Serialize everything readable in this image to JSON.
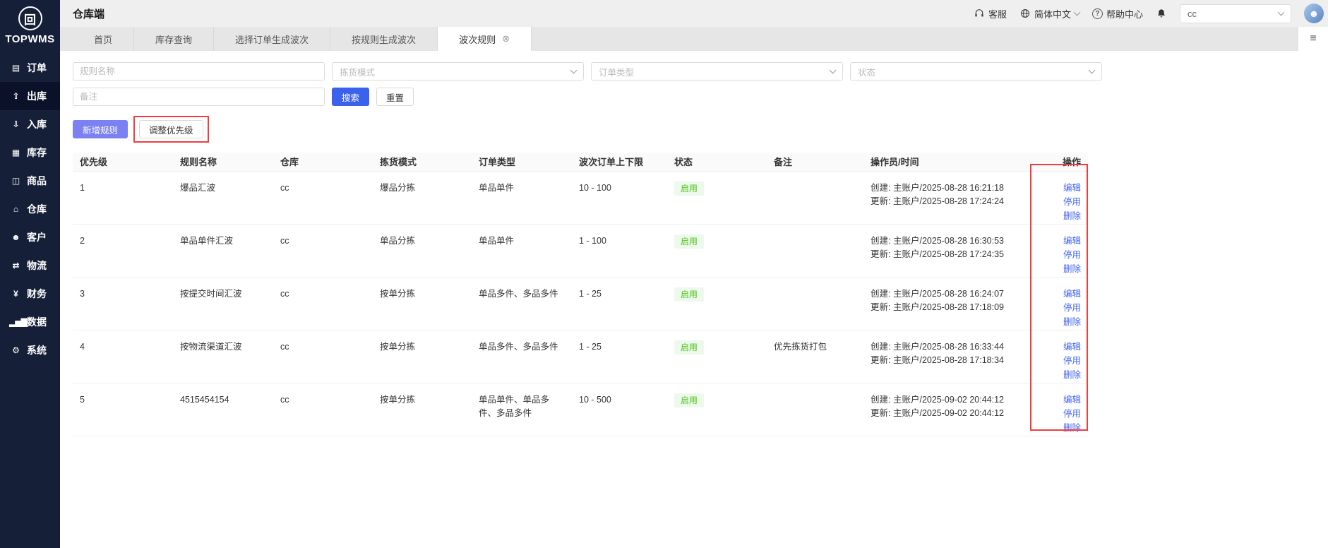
{
  "app": {
    "logo_text": "TOPWMS",
    "title": "仓库端"
  },
  "header": {
    "customer_service": "客服",
    "language": "简体中文",
    "help_center": "帮助中心",
    "warehouse_select_value": "cc"
  },
  "sidebar": {
    "items": [
      {
        "label": "订单",
        "glyph": "▤"
      },
      {
        "label": "出库",
        "glyph": "⇧"
      },
      {
        "label": "入库",
        "glyph": "⇩"
      },
      {
        "label": "库存",
        "glyph": "▦"
      },
      {
        "label": "商品",
        "glyph": "◫"
      },
      {
        "label": "仓库",
        "glyph": "⌂"
      },
      {
        "label": "客户",
        "glyph": "☻"
      },
      {
        "label": "物流",
        "glyph": "⇄"
      },
      {
        "label": "财务",
        "glyph": "¥"
      },
      {
        "label": "数据",
        "glyph": "▂▅▇"
      },
      {
        "label": "系统",
        "glyph": "⚙"
      }
    ]
  },
  "tabs": {
    "items": [
      {
        "label": "首页"
      },
      {
        "label": "库存查询"
      },
      {
        "label": "选择订单生成波次"
      },
      {
        "label": "按规则生成波次"
      },
      {
        "label": "波次规则"
      }
    ],
    "close_glyph": "⊗",
    "menu_glyph": "≡"
  },
  "filters": {
    "rule_name_placeholder": "规则名称",
    "pick_mode_placeholder": "拣货模式",
    "order_type_placeholder": "订单类型",
    "status_placeholder": "状态",
    "remark_placeholder": "备注",
    "search": "搜索",
    "reset": "重置"
  },
  "toolbar": {
    "add_rule": "新增规则",
    "adjust_priority": "调整优先级"
  },
  "table": {
    "headers": [
      "优先级",
      "规则名称",
      "仓库",
      "拣货模式",
      "订单类型",
      "波次订单上下限",
      "状态",
      "备注",
      "操作员/时间",
      "操作"
    ],
    "created_label": "创建:",
    "updated_label": "更新:",
    "actions": {
      "edit": "编辑",
      "disable": "停用",
      "delete": "删除"
    },
    "rows": [
      {
        "priority": "1",
        "rule_name": "爆品汇波",
        "warehouse": "cc",
        "pick_mode": "爆品分拣",
        "order_type": "单品单件",
        "wave_limit": "10 - 100",
        "status": "启用",
        "remark": "",
        "created": "主账户/2025-08-28 16:21:18",
        "updated": "主账户/2025-08-28 17:24:24"
      },
      {
        "priority": "2",
        "rule_name": "单品单件汇波",
        "warehouse": "cc",
        "pick_mode": "单品分拣",
        "order_type": "单品单件",
        "wave_limit": "1 - 100",
        "status": "启用",
        "remark": "",
        "created": "主账户/2025-08-28 16:30:53",
        "updated": "主账户/2025-08-28 17:24:35"
      },
      {
        "priority": "3",
        "rule_name": "按提交时间汇波",
        "warehouse": "cc",
        "pick_mode": "按单分拣",
        "order_type": "单品多件、多品多件",
        "wave_limit": "1 - 25",
        "status": "启用",
        "remark": "",
        "created": "主账户/2025-08-28 16:24:07",
        "updated": "主账户/2025-08-28 17:18:09"
      },
      {
        "priority": "4",
        "rule_name": "按物流渠道汇波",
        "warehouse": "cc",
        "pick_mode": "按单分拣",
        "order_type": "单品多件、多品多件",
        "wave_limit": "1 - 25",
        "status": "启用",
        "remark": "优先拣货打包",
        "created": "主账户/2025-08-28 16:33:44",
        "updated": "主账户/2025-08-28 17:18:34"
      },
      {
        "priority": "5",
        "rule_name": "4515454154",
        "warehouse": "cc",
        "pick_mode": "按单分拣",
        "order_type": "单品单件、单品多件、多品多件",
        "wave_limit": "10 - 500",
        "status": "启用",
        "remark": "",
        "created": "主账户/2025-09-02 20:44:12",
        "updated": "主账户/2025-09-02 20:44:12"
      }
    ]
  },
  "colors": {
    "sidebar_bg": "#161f38",
    "primary_blue": "#3a62ec",
    "add_button_purple": "#7b80f2",
    "link_blue": "#4263eb",
    "status_green": "#52c41a",
    "status_green_bg": "#ecf9ec",
    "annotation_red": "#f23d3d"
  }
}
